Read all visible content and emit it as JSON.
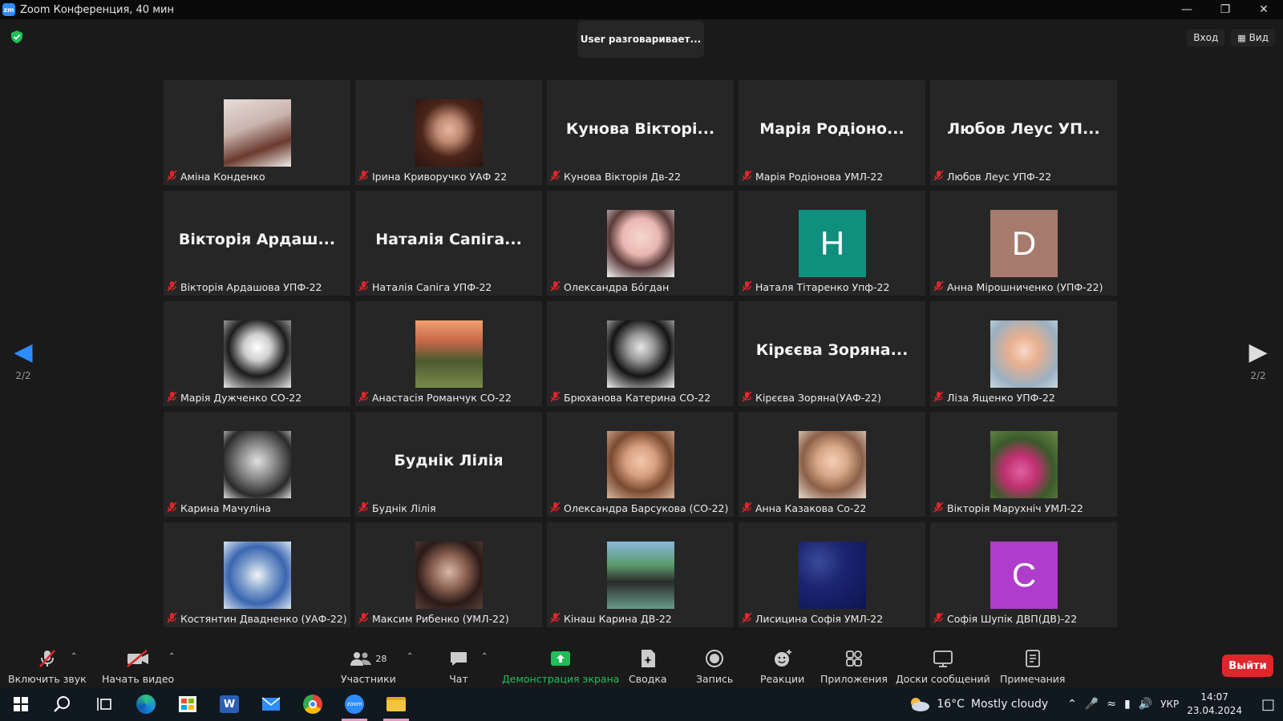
{
  "window": {
    "title": "Zoom Конференция, 40 мин"
  },
  "speaking_banner": "User разговаривает...",
  "top_right": {
    "login": "Вход",
    "view": "Вид"
  },
  "pager": {
    "left": "2/2",
    "right": "2/2"
  },
  "tiles": [
    {
      "name": "Аміна Конденко",
      "type": "photo",
      "photo": "linear-gradient(160deg,#e8dcd8 0%,#c9b4ae 40%,#6b3a2e 70%,#f0ebe8 100%)"
    },
    {
      "name": "Ірина Криворучко УАФ 22",
      "type": "photo",
      "photo": "radial-gradient(circle at 50% 45%,#e6b59e 0%,#c08a73 25%,#4a2418 55%,#2a1410 100%)"
    },
    {
      "name": "Кунова Вікторія Дв-22",
      "type": "text",
      "display": "Кунова Вікторі..."
    },
    {
      "name": "Марія Родіонова УМЛ-22",
      "type": "text",
      "display": "Марія Родіоно..."
    },
    {
      "name": "Любов Леус УПФ-22",
      "type": "text",
      "display": "Любов Леус УП..."
    },
    {
      "name": "Вікторія Ардашова УПФ-22",
      "type": "text",
      "display": "Вікторія Ардаш..."
    },
    {
      "name": "Наталія Сапіга УПФ-22",
      "type": "text",
      "display": "Наталія Сапіга..."
    },
    {
      "name": "Олександра Бóгдан",
      "type": "photo",
      "photo": "radial-gradient(circle at 50% 40%,#f6d8d2 0%,#e9b7b0 35%,#5a3b3a 60%,#f4f4f4 100%)"
    },
    {
      "name": "Наталя Тітаренко Упф-22",
      "type": "letter",
      "letter": "Н",
      "color": "#0f8f7e"
    },
    {
      "name": "Анна Мірошниченко (УПФ-22)",
      "type": "letter",
      "letter": "D",
      "color": "#a77a6e"
    },
    {
      "name": "Марія Дужченко СО-22",
      "type": "photo",
      "photo": "radial-gradient(circle at 50% 40%,#ffffff 0%,#cfcfcf 25%,#1c1c1c 55%,#e8e8e8 100%)"
    },
    {
      "name": "Анастасія Романчук СО-22",
      "type": "photo",
      "photo": "linear-gradient(180deg,#f0a070 0%,#c8684a 30%,#4b5a2e 60%,#7a8a4a 100%)"
    },
    {
      "name": "Брюханова Катерина СО-22",
      "type": "photo",
      "photo": "radial-gradient(circle at 50% 40%,#e8e8e8 0%,#9a9a9a 25%,#141414 55%,#f0f0f0 100%)"
    },
    {
      "name": "Кірєєва Зоряна(УАФ-22)",
      "type": "text",
      "display": "Кірєєва Зоряна..."
    },
    {
      "name": "Ліза Ященко УПФ-22",
      "type": "photo",
      "photo": "radial-gradient(circle at 50% 45%,#f8d8c8 0%,#e8b090 30%,#9ab0c0 70%,#c8d8e0 100%)"
    },
    {
      "name": "Карина Мачуліна",
      "type": "photo",
      "photo": "radial-gradient(circle at 50% 45%,#e0e0e0 0%,#8a8a8a 35%,#2a2a2a 70%,#dcdcdc 100%)"
    },
    {
      "name": "Буднік Лілія",
      "type": "text",
      "display": "Буднік Лілія"
    },
    {
      "name": "Олександра Барсукова (СО-22)",
      "type": "photo",
      "photo": "radial-gradient(circle at 50% 45%,#f2c8b0 0%,#d8a080 30%,#7a4a30 60%,#d8b8a0 100%)"
    },
    {
      "name": "Анна Казакова Со-22",
      "type": "photo",
      "photo": "radial-gradient(circle at 50% 45%,#f4d0b8 0%,#d8a888 30%,#8a6048 60%,#e8d8cc 100%)"
    },
    {
      "name": "Вікторія Марухніч УМЛ-22",
      "type": "photo",
      "photo": "radial-gradient(circle at 45% 60%,#e060a0 0%,#c03070 30%,#3a5a2a 60%,#6a8a4a 100%)"
    },
    {
      "name": "Костянтин Двадненко (УАФ-22)",
      "type": "photo",
      "photo": "radial-gradient(circle at 50% 50%,#f0f4f8 0%,#8aa8d0 30%,#3a66b0 60%,#d8e4f0 100%)"
    },
    {
      "name": "Максим Рибенко (УМЛ-22)",
      "type": "photo",
      "photo": "radial-gradient(circle at 50% 45%,#d8b8a8 0%,#8a6050 35%,#2a1a18 65%,#5a4038 100%)"
    },
    {
      "name": "Кінаш Карина ДВ-22",
      "type": "photo",
      "photo": "linear-gradient(180deg,#8ab8e0 0%,#5a9a6a 35%,#2a2a2a 60%,#6a9a8a 100%)"
    },
    {
      "name": "Лисицина Софія УМЛ-22",
      "type": "photo",
      "photo": "radial-gradient(circle at 30% 30%,#3a4a9a 0%,#1a2470 40%,#0e1450 100%)"
    },
    {
      "name": "Софія Шупік ДВП(ДВ)-22",
      "type": "letter",
      "letter": "C",
      "color": "#b03ccc"
    }
  ],
  "toolbar": {
    "unmute": "Включить звук",
    "start_video": "Начать видео",
    "participants": "Участники",
    "participants_count": "28",
    "chat": "Чат",
    "share": "Демонстрация экрана",
    "summary": "Сводка",
    "record": "Запись",
    "reactions": "Реакции",
    "apps": "Приложения",
    "whiteboards": "Доски сообщений",
    "notes": "Примечания",
    "leave": "Выйти"
  },
  "taskbar": {
    "weather_temp": "16°C",
    "weather_desc": "Mostly cloudy",
    "lang": "УКР",
    "time": "14:07",
    "date": "23.04.2024"
  },
  "colors": {
    "accent": "#2d8cff",
    "leave": "#e0262b",
    "share_green": "#1fbe5a",
    "mute_red": "#e0262b"
  }
}
